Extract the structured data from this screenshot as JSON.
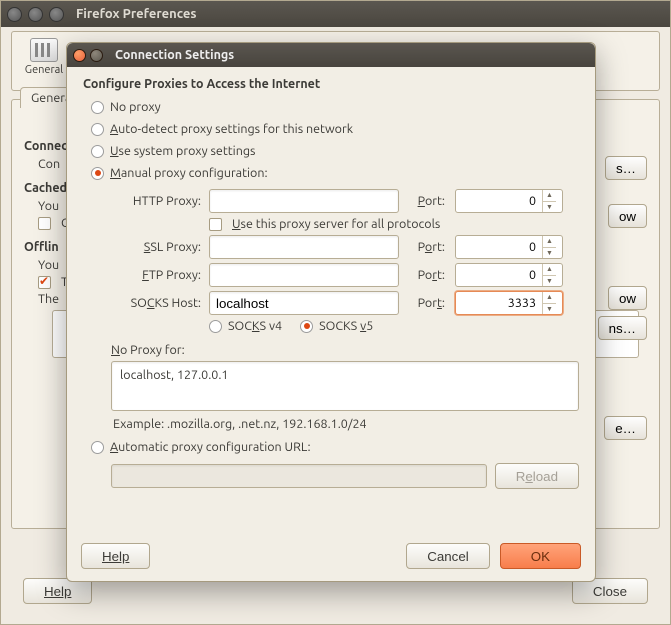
{
  "pref": {
    "title": "Firefox Preferences",
    "toolbar_item": "General",
    "tab_label": "General",
    "sections": {
      "connection": "Connection",
      "connection_sub": "Con",
      "cache": "Cached",
      "cache_sub": "You",
      "offline": "Offlin",
      "offline_sub": "You",
      "the": "The"
    },
    "buttons": {
      "s": "s…",
      "ow1": "ow",
      "ow2": "ow",
      "ns": "ns…",
      "e": "e…"
    },
    "checkbox_c": "C",
    "checkbox_t": "T",
    "help": "Help",
    "close": "Close"
  },
  "dlg": {
    "title": "Connection Settings",
    "header": "Configure Proxies to Access the Internet",
    "radios": {
      "no_proxy": "No proxy",
      "auto_detect_pre": "",
      "auto_detect_u": "A",
      "auto_detect_rest": "uto-detect proxy settings for this network",
      "system_u": "U",
      "system_rest": "se system proxy settings",
      "manual_u": "M",
      "manual_rest": "anual proxy configuration:",
      "pac_u": "A",
      "pac_rest": "utomatic proxy configuration URL:"
    },
    "labels": {
      "http": "HTTP Proxy:",
      "ssl_u": "S",
      "ssl_rest": "SL Proxy:",
      "ftp_u": "F",
      "ftp_rest": "TP Proxy:",
      "socks_pre": "SO",
      "socks_u": "C",
      "socks_rest": "KS Host:",
      "port_u": "P",
      "port_rest": "ort:",
      "use_all_u": "U",
      "use_all_rest": "se this proxy server for all protocols",
      "v4_pre": "SOC",
      "v4_u": "K",
      "v4_rest": "S v4",
      "v5_pre": "SOCKS ",
      "v5_u": "v",
      "v5_rest": "5",
      "noproxy_u": "N",
      "noproxy_rest": "o Proxy for:",
      "example": "Example: .mozilla.org, .net.nz, 192.168.1.0/24"
    },
    "values": {
      "http_host": "",
      "http_port": "0",
      "ssl_host": "",
      "ssl_port": "0",
      "ftp_host": "",
      "ftp_port": "0",
      "socks_host": "localhost",
      "socks_port": "3333",
      "noproxy": "localhost, 127.0.0.1",
      "pac_url": ""
    },
    "buttons": {
      "reload": "Reload",
      "help": "Help",
      "cancel": "Cancel",
      "ok": "OK"
    }
  }
}
